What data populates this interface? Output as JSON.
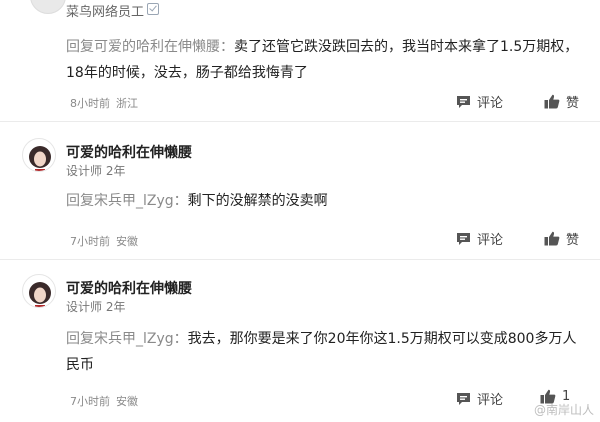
{
  "header": {
    "title": "菜鸟网络员工"
  },
  "comments": [
    {
      "reply_prefix": "回复可爱的哈利在伸懒腰：",
      "reply_text": "卖了还管它跌没跌回去的，我当时本来拿了1.5万期权，18年的时候，没去，肠子都给我悔青了",
      "time": "8小时前",
      "location": "浙江",
      "comment_label": "评论",
      "like_label": "赞"
    },
    {
      "username": "可爱的哈利在伸懒腰",
      "user_meta": "设计师 2年",
      "reply_prefix": "回复宋兵甲_lZyg：",
      "reply_text": "剩下的没解禁的没卖啊",
      "time": "7小时前",
      "location": "安徽",
      "comment_label": "评论",
      "like_label": "赞"
    },
    {
      "username": "可爱的哈利在伸懒腰",
      "user_meta": "设计师 2年",
      "reply_prefix": "回复宋兵甲_lZyg：",
      "reply_text": "我去，那你要是来了你20年你这1.5万期权可以变成800多万人民币",
      "time": "7小时前",
      "location": "安徽",
      "comment_label": "评论",
      "like_count": "1"
    }
  ],
  "watermark": "@南岸山人",
  "icons": {
    "comment": "comment-icon",
    "like": "thumbs-up-icon",
    "verified": "verified-badge-icon"
  }
}
